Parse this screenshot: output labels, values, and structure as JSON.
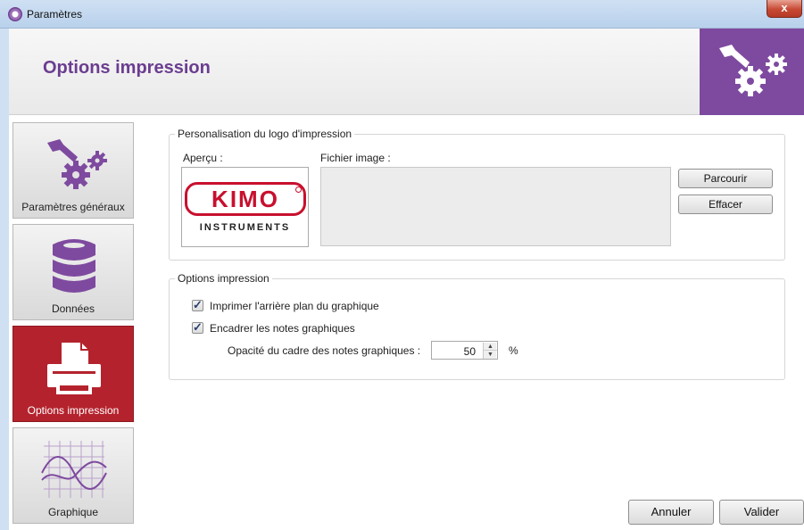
{
  "window": {
    "title": "Paramètres",
    "close_glyph": "x"
  },
  "header": {
    "title": "Options impression",
    "logo_icon": "gears-icon"
  },
  "sidebar": {
    "items": [
      {
        "label": "Paramètres généraux",
        "icon": "gears-icon",
        "active": false
      },
      {
        "label": "Données",
        "icon": "database-icon",
        "active": false
      },
      {
        "label": "Options impression",
        "icon": "printer-icon",
        "active": true
      },
      {
        "label": "Graphique",
        "icon": "chart-icon",
        "active": false
      }
    ]
  },
  "logo_group": {
    "legend": "Personalisation du logo d'impression",
    "preview_label": "Aperçu :",
    "file_label": "Fichier image :",
    "preview_logo": {
      "brand": "KIMO",
      "sub": "INSTRUMENTS"
    },
    "browse_button": "Parcourir",
    "clear_button": "Effacer"
  },
  "print_group": {
    "legend": "Options impression",
    "checkbox1": {
      "label": "Imprimer l'arrière plan du graphique",
      "checked": true
    },
    "checkbox2": {
      "label": "Encadrer les notes graphiques",
      "checked": true
    },
    "opacity_label": "Opacité du cadre des notes graphiques :",
    "opacity_value": "50",
    "opacity_unit": "%"
  },
  "footer": {
    "cancel_button": "Annuler",
    "validate_button": "Valider"
  },
  "colors": {
    "accent": "#7e4a9f",
    "active_nav": "#b4232d",
    "title": "#6b3d90"
  }
}
